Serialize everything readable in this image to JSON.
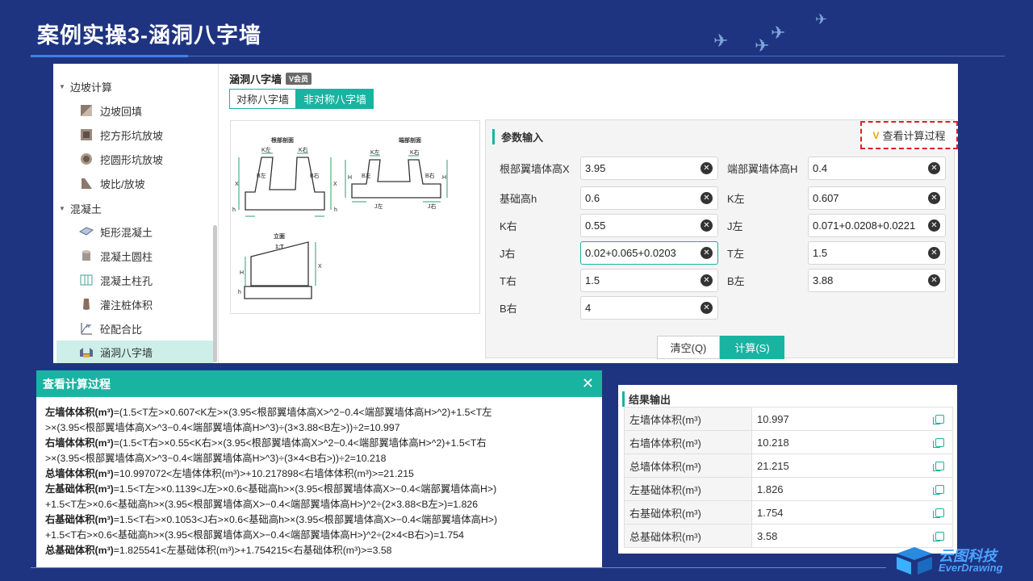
{
  "slide": {
    "title": "案例实操3-涵洞八字墙"
  },
  "sidebar": {
    "groups": [
      {
        "label": "边坡计算"
      },
      {
        "label": "混凝土"
      }
    ],
    "items": [
      {
        "label": "边坡回填"
      },
      {
        "label": "挖方形坑放坡"
      },
      {
        "label": "挖圆形坑放坡"
      },
      {
        "label": "坡比/放坡"
      },
      {
        "label": "矩形混凝土"
      },
      {
        "label": "混凝土圆柱"
      },
      {
        "label": "混凝土柱孔"
      },
      {
        "label": "灌注桩体积"
      },
      {
        "label": "砼配合比"
      },
      {
        "label": "涵洞八字墙"
      }
    ]
  },
  "module": {
    "title": "涵洞八字墙",
    "badge": "会员",
    "tabs": [
      {
        "label": "对称八字墙"
      },
      {
        "label": "非对称八字墙"
      }
    ]
  },
  "figure": {
    "section_root": "根部剖面",
    "section_end": "端部剖面",
    "elevation": "立面",
    "slope": "1:T"
  },
  "params": {
    "header": "参数输入",
    "view_process": "查看计算过程",
    "fields": [
      {
        "label": "根部翼墙体高X",
        "value": "3.95"
      },
      {
        "label": "端部翼墙体高H",
        "value": "0.4"
      },
      {
        "label": "基础高h",
        "value": "0.6"
      },
      {
        "label": "K左",
        "value": "0.607"
      },
      {
        "label": "K右",
        "value": "0.55"
      },
      {
        "label": "J左",
        "value": "0.071+0.0208+0.0221"
      },
      {
        "label": "J右",
        "value": "0.02+0.065+0.0203"
      },
      {
        "label": "T左",
        "value": "1.5"
      },
      {
        "label": "T右",
        "value": "1.5"
      },
      {
        "label": "B左",
        "value": "3.88"
      },
      {
        "label": "B右",
        "value": "4"
      }
    ],
    "clear": "清空(Q)",
    "calc": "计算(S)"
  },
  "calc_panel": {
    "title": "查看计算过程",
    "lines": [
      {
        "b": "左墙体体积(m³)",
        "t": "=(1.5<T左>×0.607<K左>×(3.95<根部翼墙体高X>^2−0.4<端部翼墙体高H>^2)+1.5<T左"
      },
      {
        "b": "",
        "t": ">×(3.95<根部翼墙体高X>^3−0.4<端部翼墙体高H>^3)÷(3×3.88<B左>))÷2=10.997"
      },
      {
        "b": "右墙体体积(m³)",
        "t": "=(1.5<T右>×0.55<K右>×(3.95<根部翼墙体高X>^2−0.4<端部翼墙体高H>^2)+1.5<T右"
      },
      {
        "b": "",
        "t": ">×(3.95<根部翼墙体高X>^3−0.4<端部翼墙体高H>^3)÷(3×4<B右>))÷2=10.218"
      },
      {
        "b": "总墙体体积(m³)",
        "t": "=10.997072<左墙体体积(m³)>+10.217898<右墙体体积(m³)>=21.215"
      },
      {
        "b": "左基础体积(m³)",
        "t": "=1.5<T左>×0.1139<J左>×0.6<基础高h>×(3.95<根部翼墙体高X>−0.4<端部翼墙体高H>)"
      },
      {
        "b": "",
        "t": "+1.5<T左>×0.6<基础高h>×(3.95<根部翼墙体高X>−0.4<端部翼墙体高H>)^2÷(2×3.88<B左>)=1.826"
      },
      {
        "b": "右基础体积(m³)",
        "t": "=1.5<T右>×0.1053<J右>×0.6<基础高h>×(3.95<根部翼墙体高X>−0.4<端部翼墙体高H>)"
      },
      {
        "b": "",
        "t": "+1.5<T右>×0.6<基础高h>×(3.95<根部翼墙体高X>−0.4<端部翼墙体高H>)^2÷(2×4<B右>)=1.754"
      },
      {
        "b": "总基础体积(m³)",
        "t": "=1.825541<左基础体积(m³)>+1.754215<右基础体积(m³)>=3.58"
      }
    ]
  },
  "results": {
    "title": "结果输出",
    "rows": [
      {
        "label": "左墙体体积(m³)",
        "value": "10.997"
      },
      {
        "label": "右墙体体积(m³)",
        "value": "10.218"
      },
      {
        "label": "总墙体体积(m³)",
        "value": "21.215"
      },
      {
        "label": "左基础体积(m³)",
        "value": "1.826"
      },
      {
        "label": "右基础体积(m³)",
        "value": "1.754"
      },
      {
        "label": "总基础体积(m³)",
        "value": "3.58"
      }
    ]
  },
  "logo": {
    "cn": "云图科技",
    "en": "EverDrawing"
  }
}
